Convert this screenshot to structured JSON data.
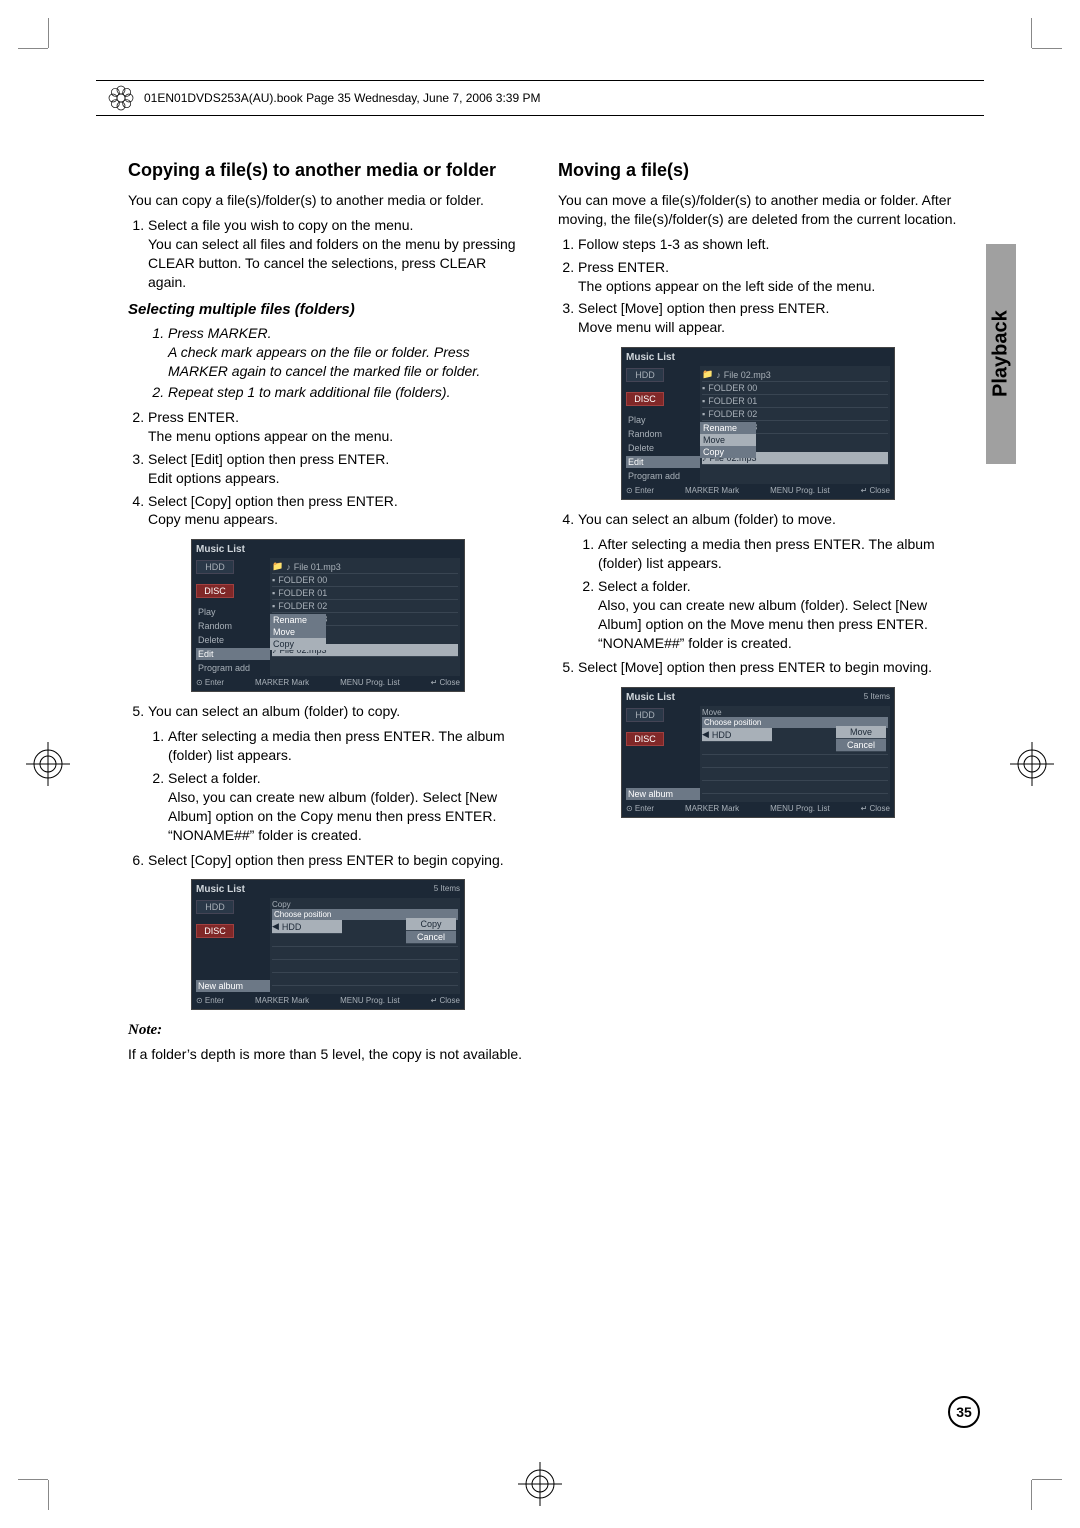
{
  "header": {
    "meta_line": "01EN01DVDS253A(AU).book  Page 35  Wednesday, June 7, 2006  3:39 PM"
  },
  "side_tab": "Playback",
  "page_number": "35",
  "left_column": {
    "heading": "Copying a file(s) to another media or folder",
    "intro": "You can copy a file(s)/folder(s) to another media or folder.",
    "step1": "Select a file you wish to copy on the menu.\nYou can select all files and folders on the menu by pressing CLEAR button. To cancel the selections, press CLEAR again.",
    "sub_heading": "Selecting multiple files (folders)",
    "sub_step1_a": "Press MARKER.",
    "sub_step1_b": "A check mark appears on the file or folder. Press MARKER again to cancel the marked file or folder.",
    "sub_step2": "Repeat step 1 to mark additional file (folders).",
    "step2": "Press ENTER.\nThe menu options appear on the menu.",
    "step3": "Select [Edit] option then press ENTER.\nEdit options appears.",
    "step4": "Select [Copy] option then press ENTER.\nCopy menu appears.",
    "step5": "You can select an album (folder) to copy.",
    "step5_1": "After selecting a media then press ENTER. The album (folder) list appears.",
    "step5_2": "Select a folder.\nAlso, you can create new album (folder). Select [New Album] option on the Copy menu then press ENTER.\n“NONAME##” folder is created.",
    "step6": "Select [Copy] option then press ENTER to begin copying.",
    "note_label": "Note:",
    "note_text": "If a folder’s depth is more than 5 level, the copy is not available."
  },
  "right_column": {
    "heading": "Moving a file(s)",
    "intro": "You can move a file(s)/folder(s) to another media or folder. After moving, the file(s)/folder(s) are deleted from the current location.",
    "step1": "Follow steps 1-3 as shown left.",
    "step2": "Press ENTER.\nThe options appear on the left side of the menu.",
    "step3": "Select [Move] option then press ENTER.\nMove menu will appear.",
    "step4": "You can select an album (folder) to move.",
    "step4_1": "After selecting a media then press ENTER. The album (folder) list appears.",
    "step4_2": "Select a folder.\nAlso, you can create new album (folder). Select [New Album] option on the Move menu then press ENTER.\n“NONAME##” folder is created.",
    "step5": "Select [Move] option then press ENTER to begin moving."
  },
  "osd_a": {
    "title": "Music List",
    "header_file": "File 01.mp3",
    "sidebar_top": "HDD",
    "sidebar_tag": "DISC",
    "sidebar_items": [
      "Play",
      "Random",
      "Delete",
      "Edit",
      "Program add"
    ],
    "rows": [
      "FOLDER 00",
      "FOLDER 01",
      "FOLDER 02",
      "FOLDER 03"
    ],
    "context": [
      "Rename",
      "Move",
      "Copy"
    ],
    "context_selected_index": 2,
    "bottom_file": "File 02.mp3",
    "footer": [
      "⊙ Enter",
      "MARKER Mark",
      "MENU Prog. List",
      "↵ Close"
    ]
  },
  "osd_b": {
    "title": "Music List",
    "top_label": "Copy",
    "sub_label": "Choose position",
    "dest": "HDD",
    "sidebar_top": "HDD",
    "sidebar_tag": "DISC",
    "buttons": [
      "Copy",
      "Cancel"
    ],
    "info_right": "5 Items",
    "sidebar_bottom": "New album",
    "footer": [
      "⊙ Enter",
      "MARKER Mark",
      "MENU Prog. List",
      "↵ Close"
    ]
  },
  "osd_c": {
    "title": "Music List",
    "header_file": "File 02.mp3",
    "sidebar_top": "HDD",
    "sidebar_tag": "DISC",
    "sidebar_items": [
      "Play",
      "Random",
      "Delete",
      "Edit",
      "Program add"
    ],
    "rows": [
      "FOLDER 00",
      "FOLDER 01",
      "FOLDER 02",
      "FOLDER 03"
    ],
    "context": [
      "Rename",
      "Move",
      "Copy"
    ],
    "context_selected_index": 1,
    "bottom_file": "File 02.mp3",
    "footer": [
      "⊙ Enter",
      "MARKER Mark",
      "MENU Prog. List",
      "↵ Close"
    ]
  },
  "osd_d": {
    "title": "Music List",
    "top_label": "Move",
    "sub_label": "Choose position",
    "dest": "HDD",
    "sidebar_top": "HDD",
    "sidebar_tag": "DISC",
    "buttons": [
      "Move",
      "Cancel"
    ],
    "info_right": "5 Items",
    "sidebar_bottom": "New album",
    "footer": [
      "⊙ Enter",
      "MARKER Mark",
      "MENU Prog. List",
      "↵ Close"
    ]
  }
}
